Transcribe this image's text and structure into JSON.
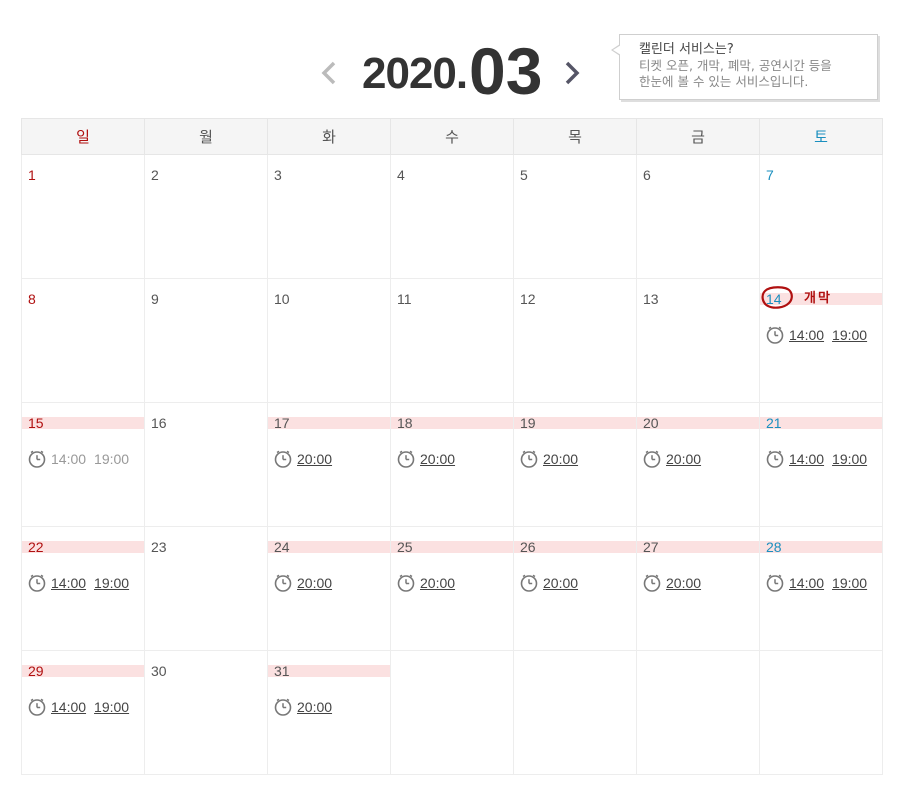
{
  "header": {
    "year": "2020.",
    "month": "03",
    "prev_icon": "chevron-left-icon",
    "next_icon": "chevron-right-icon"
  },
  "tooltip": {
    "title": "캘린더 서비스는?",
    "line1": "티켓 오픈, 개막, 폐막, 공연시간 등을",
    "line2": "한눈에 볼 수 있는 서비스입니다."
  },
  "weekdays": [
    "일",
    "월",
    "화",
    "수",
    "목",
    "금",
    "토"
  ],
  "colors": {
    "sunday": "#b01010",
    "saturday": "#1a8fbf",
    "highlight": "#fbe1e1",
    "opening": "#b01010"
  },
  "weeks": [
    {
      "days": [
        {
          "n": "1"
        },
        {
          "n": "2"
        },
        {
          "n": "3"
        },
        {
          "n": "4"
        },
        {
          "n": "5"
        },
        {
          "n": "6"
        },
        {
          "n": "7"
        }
      ]
    },
    {
      "days": [
        {
          "n": "8"
        },
        {
          "n": "9"
        },
        {
          "n": "10"
        },
        {
          "n": "11"
        },
        {
          "n": "12"
        },
        {
          "n": "13"
        },
        {
          "n": "14",
          "hl": true,
          "opening": "개막",
          "times": [
            "14:00",
            "19:00"
          ]
        }
      ]
    },
    {
      "days": [
        {
          "n": "15",
          "hl": true,
          "times": [
            "14:00",
            "19:00"
          ],
          "disabled": true
        },
        {
          "n": "16"
        },
        {
          "n": "17",
          "hl": true,
          "times": [
            "20:00"
          ]
        },
        {
          "n": "18",
          "hl": true,
          "times": [
            "20:00"
          ]
        },
        {
          "n": "19",
          "hl": true,
          "times": [
            "20:00"
          ]
        },
        {
          "n": "20",
          "hl": true,
          "times": [
            "20:00"
          ]
        },
        {
          "n": "21",
          "hl": true,
          "times": [
            "14:00",
            "19:00"
          ]
        }
      ]
    },
    {
      "days": [
        {
          "n": "22",
          "hl": true,
          "times": [
            "14:00",
            "19:00"
          ]
        },
        {
          "n": "23"
        },
        {
          "n": "24",
          "hl": true,
          "times": [
            "20:00"
          ]
        },
        {
          "n": "25",
          "hl": true,
          "times": [
            "20:00"
          ]
        },
        {
          "n": "26",
          "hl": true,
          "times": [
            "20:00"
          ]
        },
        {
          "n": "27",
          "hl": true,
          "times": [
            "20:00"
          ]
        },
        {
          "n": "28",
          "hl": true,
          "times": [
            "14:00",
            "19:00"
          ]
        }
      ]
    },
    {
      "days": [
        {
          "n": "29",
          "hl": true,
          "times": [
            "14:00",
            "19:00"
          ]
        },
        {
          "n": "30"
        },
        {
          "n": "31",
          "hl": true,
          "times": [
            "20:00"
          ]
        },
        {
          "n": ""
        },
        {
          "n": ""
        },
        {
          "n": ""
        },
        {
          "n": ""
        }
      ]
    }
  ]
}
